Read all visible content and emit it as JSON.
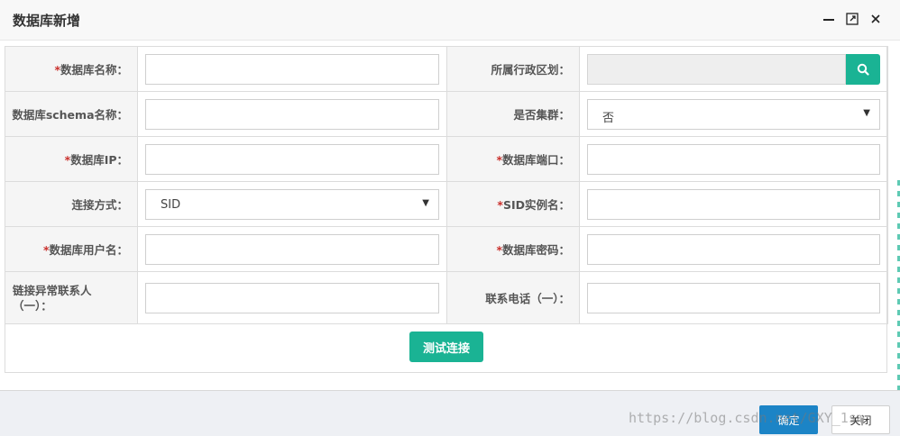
{
  "dialog": {
    "title": "数据库新增"
  },
  "form": {
    "db_name_label": "数据库名称：",
    "region_label": "所属行政区划：",
    "schema_label": "数据库schema名称：",
    "cluster_label": "是否集群：",
    "cluster_value": "否",
    "ip_label": "数据库IP：",
    "port_label": "数据库端口：",
    "conn_mode_label": "连接方式：",
    "conn_mode_value": "SID",
    "sid_label": "SID实例名：",
    "user_label": "数据库用户名：",
    "password_label": "数据库密码：",
    "contact_label_line1": "链接异常联系人",
    "contact_label_line2": "（一）：",
    "phone_label": "联系电话（一）：",
    "required_mark": "*",
    "test_button": "测试连接"
  },
  "footer": {
    "ok_button": "确定",
    "close_button": "关闭"
  },
  "watermark": "https://blog.csdn.net/GXY_1sm",
  "icons": {
    "minimize": "minimize-icon",
    "maximize": "maximize-icon",
    "close": "close-icon",
    "search": "search-icon",
    "dropdown": "caret-down-icon"
  },
  "colors": {
    "accent": "#1ab394",
    "primary": "#1c84c6",
    "required": "#c9302c"
  }
}
